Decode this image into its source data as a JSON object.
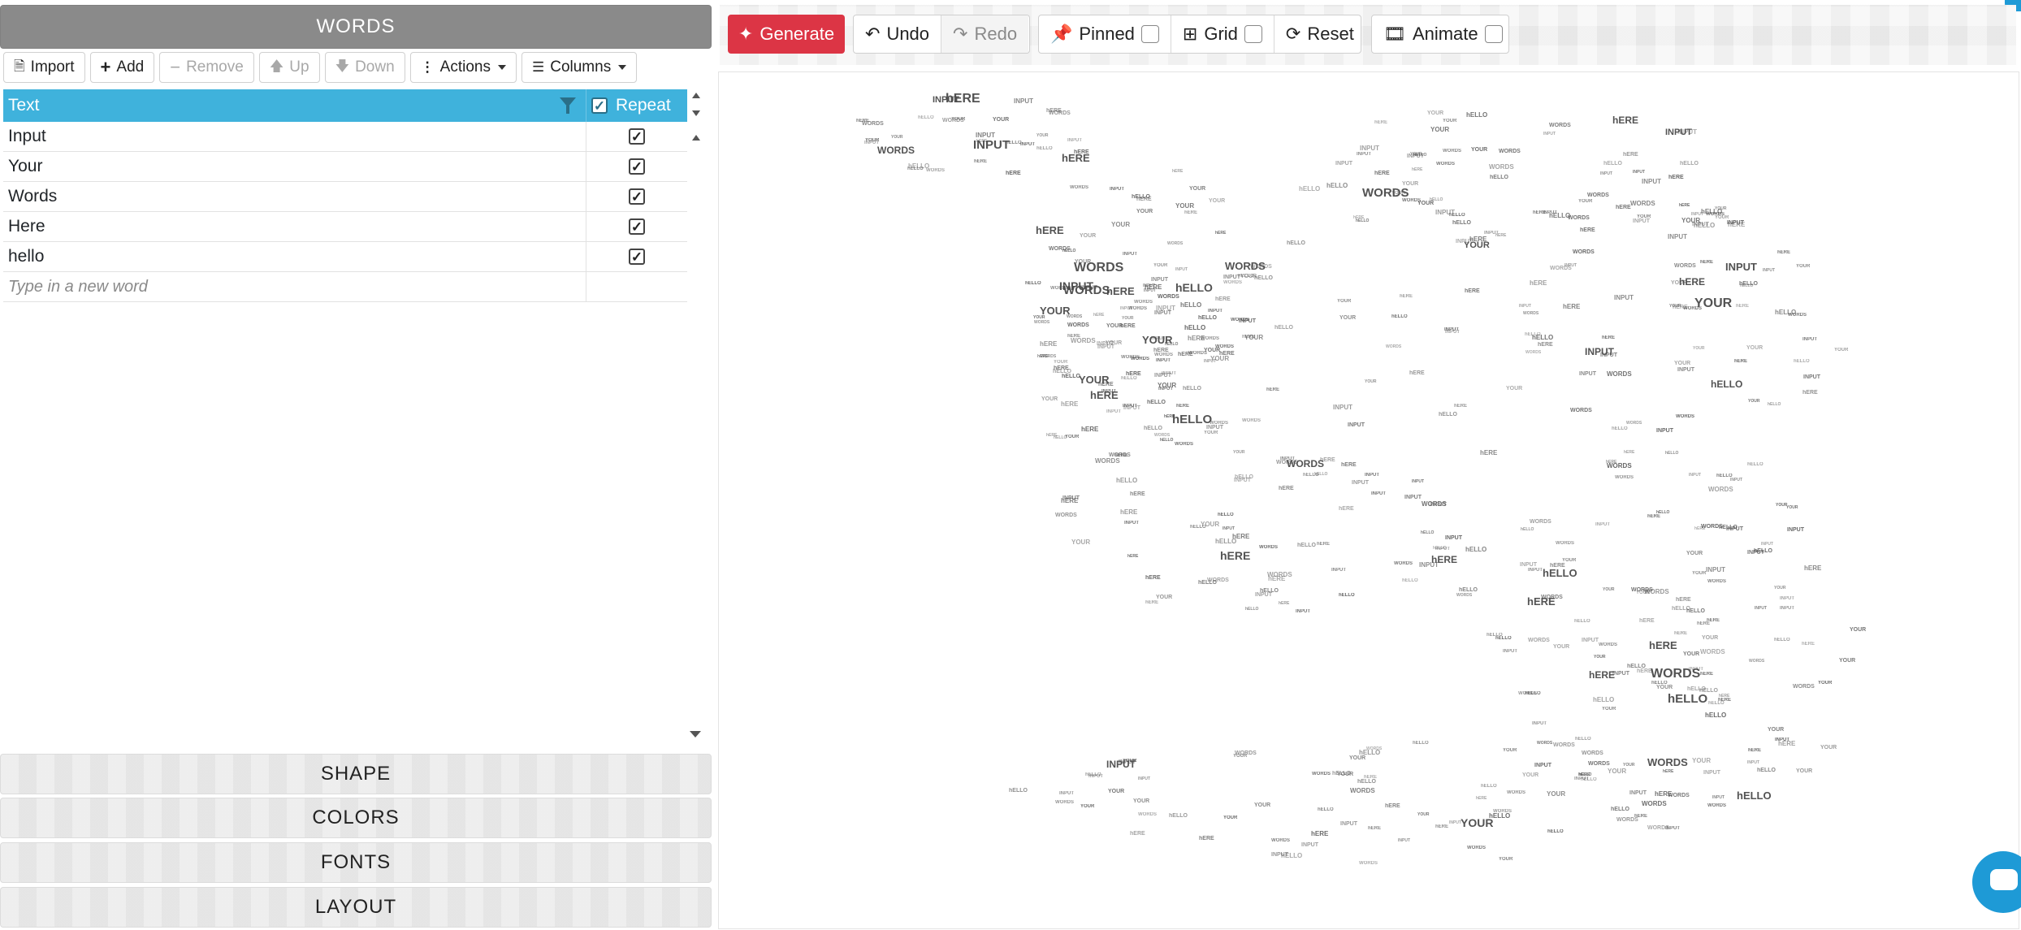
{
  "panel": {
    "words_title": "WORDS",
    "shape_title": "SHAPE",
    "colors_title": "COLORS",
    "fonts_title": "FONTS",
    "layout_title": "LAYOUT"
  },
  "toolbar": {
    "import": "Import",
    "add": "Add",
    "remove": "Remove",
    "up": "Up",
    "down": "Down",
    "actions": "Actions",
    "columns": "Columns"
  },
  "grid": {
    "col_text": "Text",
    "col_repeat": "Repeat",
    "rows": [
      {
        "text": "Input",
        "repeat": true
      },
      {
        "text": "Your",
        "repeat": true
      },
      {
        "text": "Words",
        "repeat": true
      },
      {
        "text": "Here",
        "repeat": true
      },
      {
        "text": "hello",
        "repeat": true
      }
    ],
    "new_placeholder": "Type in a new word"
  },
  "topbar": {
    "generate": "Generate",
    "undo": "Undo",
    "redo": "Redo",
    "pinned": "Pinned",
    "grid": "Grid",
    "reset": "Reset",
    "animate": "Animate"
  },
  "cloud": {
    "words": [
      "INPUT",
      "YOUR",
      "WORDS",
      "hERE",
      "hELLO"
    ],
    "text_color": "#4a4a4a"
  },
  "colors": {
    "accent": "#3fb2dc",
    "generate": "#dc3545",
    "chat": "#1e9ad6"
  }
}
